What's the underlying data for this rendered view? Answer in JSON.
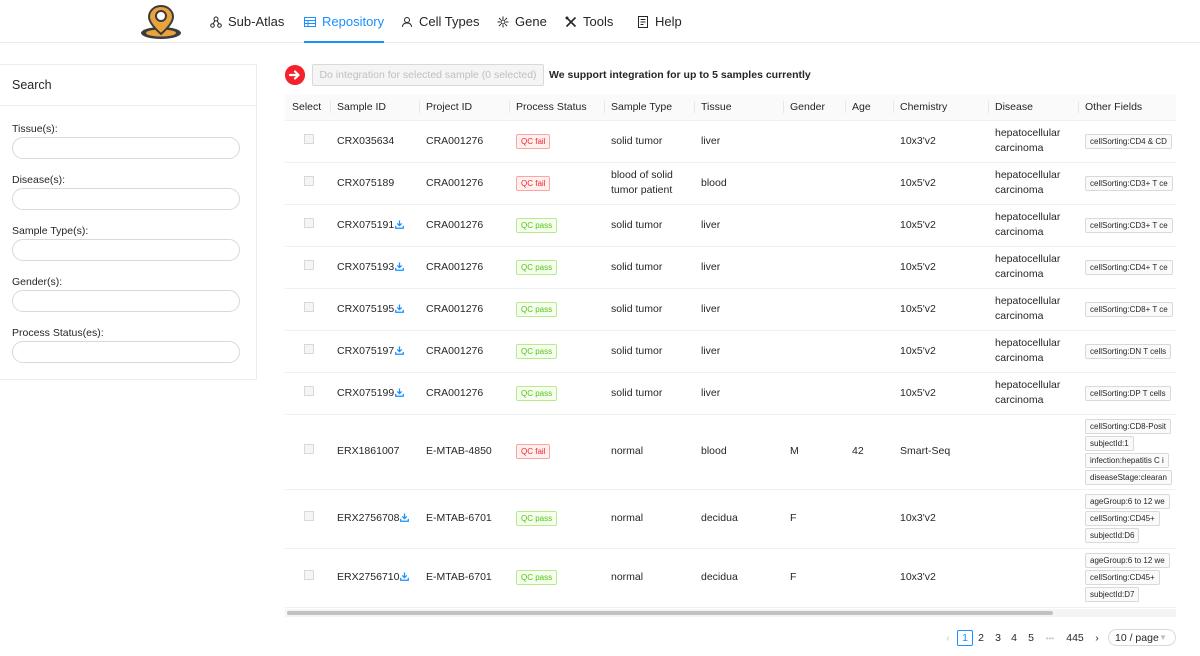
{
  "nav": {
    "items": [
      {
        "label": "Sub-Atlas",
        "icon": "sub-atlas-icon"
      },
      {
        "label": "Repository",
        "icon": "repository-icon",
        "active": true
      },
      {
        "label": "Cell Types",
        "icon": "cell-types-icon"
      },
      {
        "label": "Gene",
        "icon": "gene-icon"
      },
      {
        "label": "Tools",
        "icon": "tools-icon"
      },
      {
        "label": "Help",
        "icon": "help-icon"
      }
    ]
  },
  "search": {
    "title": "Search",
    "fields": [
      {
        "label": "Tissue(s):",
        "value": ""
      },
      {
        "label": "Disease(s):",
        "value": ""
      },
      {
        "label": "Sample Type(s):",
        "value": ""
      },
      {
        "label": "Gender(s):",
        "value": ""
      },
      {
        "label": "Process Status(es):",
        "value": ""
      }
    ]
  },
  "toolbar": {
    "integrate_label": "Do integration for selected sample (0 selected)",
    "note": "We support integration for up to 5 samples currently"
  },
  "table": {
    "columns": [
      "Select",
      "Sample ID",
      "Project ID",
      "Process Status",
      "Sample Type",
      "Tissue",
      "Gender",
      "Age",
      "Chemistry",
      "Disease",
      "Other Fields"
    ],
    "rows": [
      {
        "sample_id": "CRX035634",
        "download": false,
        "project_id": "CRA001276",
        "status": "QC fail",
        "sample_type": [
          "solid tumor"
        ],
        "tissue": "liver",
        "gender": "",
        "age": "",
        "chemistry": "10x3'v2",
        "disease": [
          "hepatocellular",
          "carcinoma"
        ],
        "other": [
          "cellSorting:CD4 & CD"
        ]
      },
      {
        "sample_id": "CRX075189",
        "download": false,
        "project_id": "CRA001276",
        "status": "QC fail",
        "sample_type": [
          "blood of solid",
          "tumor patient"
        ],
        "tissue": "blood",
        "gender": "",
        "age": "",
        "chemistry": "10x5'v2",
        "disease": [
          "hepatocellular",
          "carcinoma"
        ],
        "other": [
          "cellSorting:CD3+ T ce"
        ]
      },
      {
        "sample_id": "CRX075191",
        "download": true,
        "project_id": "CRA001276",
        "status": "QC pass",
        "sample_type": [
          "solid tumor"
        ],
        "tissue": "liver",
        "gender": "",
        "age": "",
        "chemistry": "10x5'v2",
        "disease": [
          "hepatocellular",
          "carcinoma"
        ],
        "other": [
          "cellSorting:CD3+ T ce"
        ]
      },
      {
        "sample_id": "CRX075193",
        "download": true,
        "project_id": "CRA001276",
        "status": "QC pass",
        "sample_type": [
          "solid tumor"
        ],
        "tissue": "liver",
        "gender": "",
        "age": "",
        "chemistry": "10x5'v2",
        "disease": [
          "hepatocellular",
          "carcinoma"
        ],
        "other": [
          "cellSorting:CD4+ T ce"
        ]
      },
      {
        "sample_id": "CRX075195",
        "download": true,
        "project_id": "CRA001276",
        "status": "QC pass",
        "sample_type": [
          "solid tumor"
        ],
        "tissue": "liver",
        "gender": "",
        "age": "",
        "chemistry": "10x5'v2",
        "disease": [
          "hepatocellular",
          "carcinoma"
        ],
        "other": [
          "cellSorting:CD8+ T ce"
        ]
      },
      {
        "sample_id": "CRX075197",
        "download": true,
        "project_id": "CRA001276",
        "status": "QC pass",
        "sample_type": [
          "solid tumor"
        ],
        "tissue": "liver",
        "gender": "",
        "age": "",
        "chemistry": "10x5'v2",
        "disease": [
          "hepatocellular",
          "carcinoma"
        ],
        "other": [
          "cellSorting:DN T cells"
        ]
      },
      {
        "sample_id": "CRX075199",
        "download": true,
        "project_id": "CRA001276",
        "status": "QC pass",
        "sample_type": [
          "solid tumor"
        ],
        "tissue": "liver",
        "gender": "",
        "age": "",
        "chemistry": "10x5'v2",
        "disease": [
          "hepatocellular",
          "carcinoma"
        ],
        "other": [
          "cellSorting:DP T cells"
        ]
      },
      {
        "sample_id": "ERX1861007",
        "download": false,
        "project_id": "E-MTAB-4850",
        "status": "QC fail",
        "sample_type": [
          "normal"
        ],
        "tissue": "blood",
        "gender": "M",
        "age": "42",
        "chemistry": "Smart-Seq",
        "disease": [],
        "other": [
          "cellSorting:CD8-Posit",
          "subjectId:1",
          "infection:hepatitis C i",
          "diseaseStage:clearan"
        ]
      },
      {
        "sample_id": "ERX2756708",
        "download": true,
        "project_id": "E-MTAB-6701",
        "status": "QC pass",
        "sample_type": [
          "normal"
        ],
        "tissue": "decidua",
        "gender": "F",
        "age": "",
        "chemistry": "10x3'v2",
        "disease": [],
        "other": [
          "ageGroup:6 to 12 we",
          "cellSorting:CD45+",
          "subjectId:D6"
        ]
      },
      {
        "sample_id": "ERX2756710",
        "download": true,
        "project_id": "E-MTAB-6701",
        "status": "QC pass",
        "sample_type": [
          "normal"
        ],
        "tissue": "decidua",
        "gender": "F",
        "age": "",
        "chemistry": "10x3'v2",
        "disease": [],
        "other": [
          "ageGroup:6 to 12 we",
          "cellSorting:CD45+",
          "subjectId:D7"
        ]
      }
    ]
  },
  "pagination": {
    "prev": "‹",
    "pages": [
      "1",
      "2",
      "3",
      "4",
      "5"
    ],
    "current": "1",
    "ellipsis": "•••",
    "last": "445",
    "next": "›",
    "page_size": "10 / page"
  },
  "colors": {
    "accent": "#1890ff",
    "fail": "#f5222d",
    "pass": "#52c41a"
  }
}
